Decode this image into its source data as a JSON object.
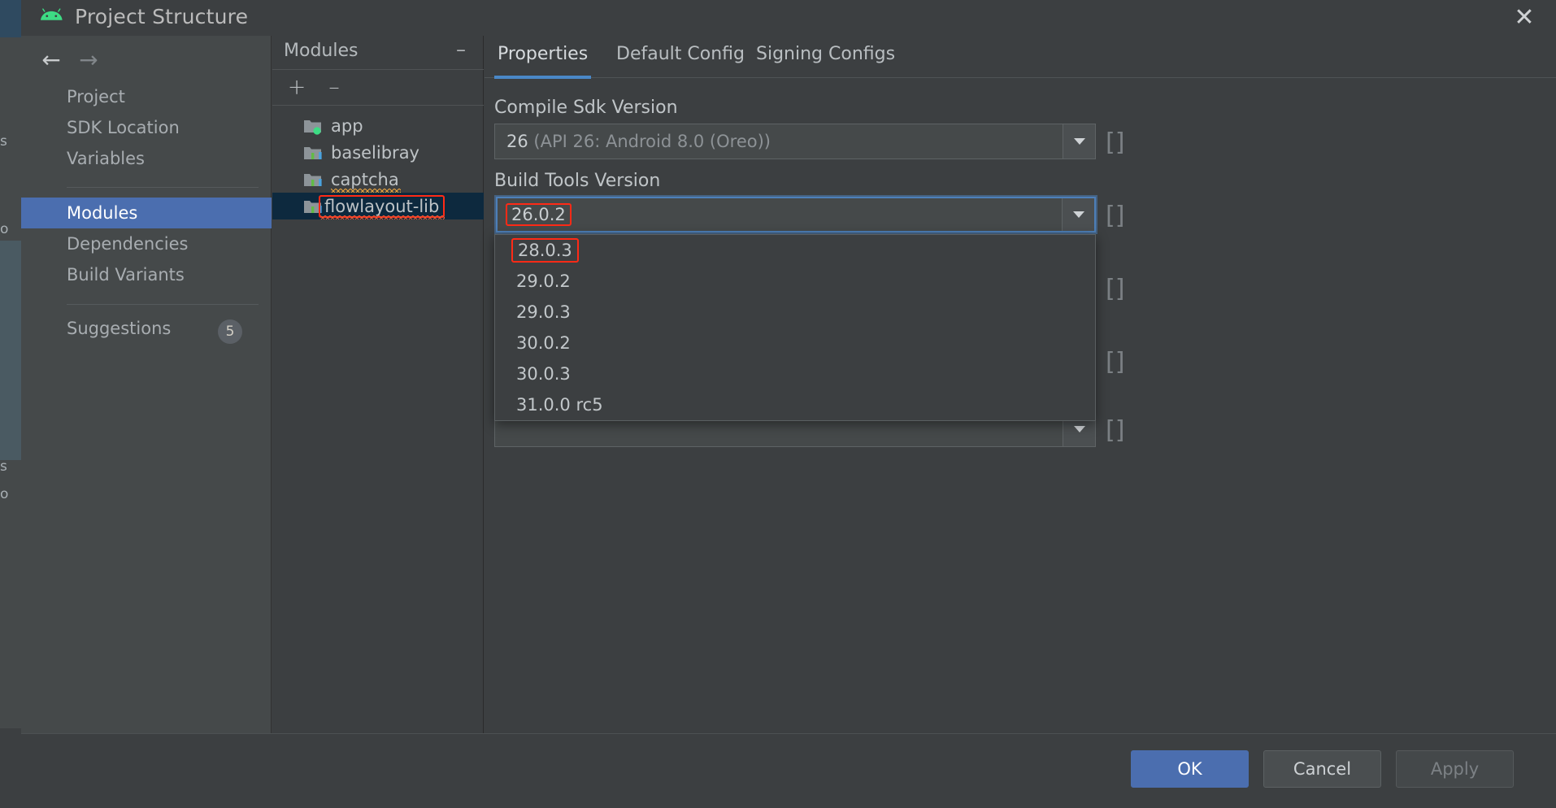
{
  "window": {
    "title": "Project Structure",
    "app_icon": "android-robot-icon",
    "close_icon": "close-icon"
  },
  "sidebar": {
    "back_icon": "arrow-left-icon",
    "forward_icon": "arrow-right-icon",
    "items": [
      {
        "label": "Project",
        "selected": false
      },
      {
        "label": "SDK Location",
        "selected": false
      },
      {
        "label": "Variables",
        "selected": false
      },
      {
        "label": "Modules",
        "selected": true
      },
      {
        "label": "Dependencies",
        "selected": false
      },
      {
        "label": "Build Variants",
        "selected": false
      },
      {
        "label": "Suggestions",
        "selected": false,
        "badge": "5"
      }
    ]
  },
  "modules_panel": {
    "title": "Modules",
    "collapse_icon": "minimize-icon",
    "add_icon": "plus-icon",
    "remove_icon": "minus-icon",
    "items": [
      {
        "label": "app",
        "icon": "module-app-folder-icon",
        "selected": false,
        "misspelled": false
      },
      {
        "label": "baselibray",
        "icon": "module-library-folder-icon",
        "selected": false,
        "misspelled": false
      },
      {
        "label": "captcha",
        "icon": "module-library-folder-icon",
        "selected": false,
        "misspelled": true
      },
      {
        "label": "flowlayout-lib",
        "icon": "module-library-folder-icon",
        "selected": true,
        "misspelled": true,
        "annotated": true
      }
    ]
  },
  "tabs": [
    {
      "label": "Properties",
      "active": true
    },
    {
      "label": "Default Config",
      "active": false
    },
    {
      "label": "Signing Configs",
      "active": false
    }
  ],
  "form": {
    "compile_sdk": {
      "label": "Compile Sdk Version",
      "value": "26",
      "value_detail": "(API 26: Android 8.0 (Oreo))",
      "dropdown_icon": "chevron-down-icon"
    },
    "build_tools": {
      "label": "Build Tools Version",
      "value": "26.0.2",
      "focused": true,
      "annotated": true,
      "dropdown_icon": "chevron-down-icon",
      "options": [
        {
          "label": "28.0.3",
          "annotated": true
        },
        {
          "label": "29.0.2",
          "annotated": false
        },
        {
          "label": "29.0.3",
          "annotated": false
        },
        {
          "label": "30.0.2",
          "annotated": false
        },
        {
          "label": "30.0.3",
          "annotated": false
        },
        {
          "label": "31.0.0 rc5",
          "annotated": false
        }
      ]
    },
    "hidden_field": {
      "value": "",
      "dropdown_icon": "chevron-down-icon"
    }
  },
  "footer": {
    "ok_label": "OK",
    "cancel_label": "Cancel",
    "apply_label": "Apply"
  },
  "colors": {
    "accent": "#4b6eaf",
    "annotation": "#ff2a16",
    "selection_dark": "#0d293e",
    "panel": "#3c3f41",
    "nav_panel": "#45494a",
    "android_green": "#3ddc84",
    "tab_underline": "#4a88c7"
  }
}
